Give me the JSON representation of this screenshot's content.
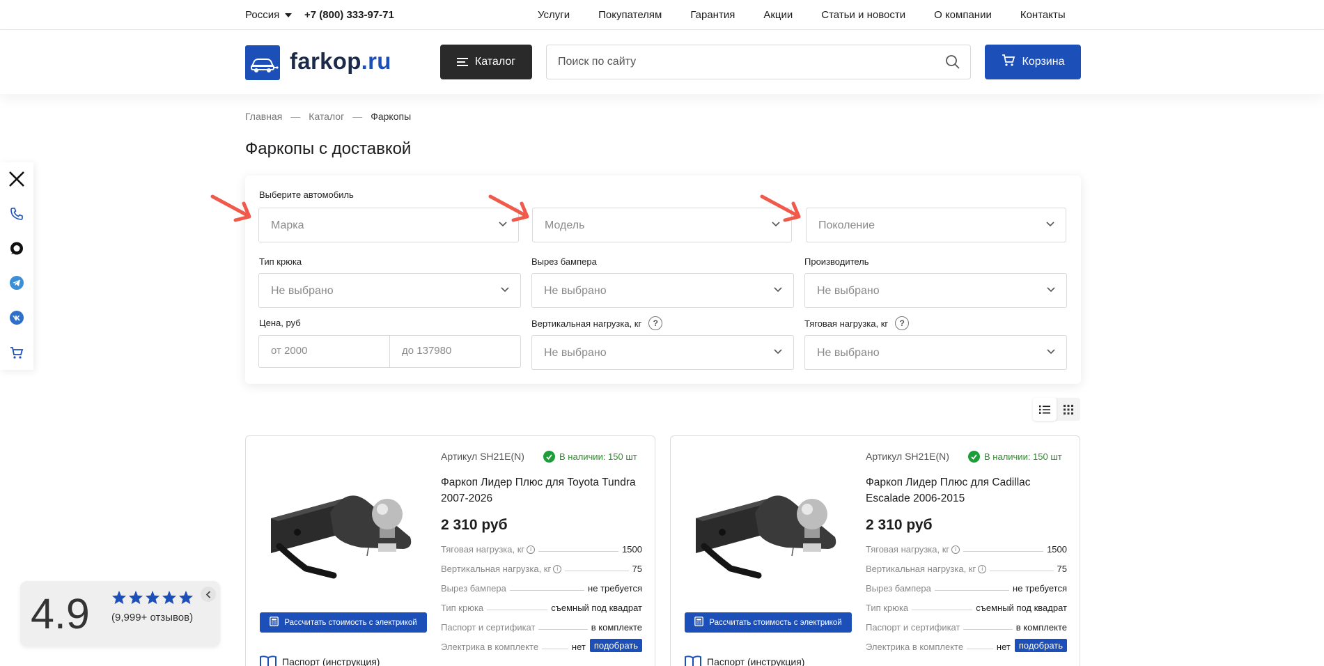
{
  "topbar": {
    "region": "Россия",
    "phone": "+7 (800) 333-97-71",
    "nav": [
      "Услуги",
      "Покупателям",
      "Гарантия",
      "Акции",
      "Статьи и новости",
      "О компании",
      "Контакты"
    ]
  },
  "header": {
    "logo_main": "farkop",
    "logo_tld": ".ru",
    "catalog_label": "Каталог",
    "search_placeholder": "Поиск по сайту",
    "cart_label": "Корзина"
  },
  "breadcrumb": {
    "items": [
      "Главная",
      "Каталог",
      "Фаркопы"
    ],
    "separator": "—"
  },
  "page_title": "Фаркопы с доставкой",
  "filters": {
    "car_label": "Выберите автомобиль",
    "make_placeholder": "Марка",
    "model_placeholder": "Модель",
    "generation_placeholder": "Поколение",
    "hook_type_label": "Тип крюка",
    "bumper_cut_label": "Вырез бампера",
    "manufacturer_label": "Производитель",
    "price_label": "Цена, руб",
    "price_from_placeholder": "от 2000",
    "price_to_placeholder": "до 137980",
    "vertical_load_label": "Вертикальная нагрузка, кг",
    "towing_load_label": "Тяговая нагрузка, кг",
    "not_selected": "Не выбрано",
    "help_symbol": "?"
  },
  "products": [
    {
      "sku": "Артикул SH21E(N)",
      "stock": "В наличии: 150 шт",
      "title": "Фаркоп Лидер Плюс для Toyota Tundra 2007-2026",
      "price": "2 310 руб",
      "calc_label": "Рассчитать стоимость с электрикой",
      "passport_label": "Паспорт (инструкция)",
      "specs": [
        {
          "name": "Тяговая нагрузка, кг",
          "value": "1500"
        },
        {
          "name": "Вертикальная нагрузка, кг",
          "value": "75"
        },
        {
          "name": "Вырез бампера",
          "value": "не требуется"
        },
        {
          "name": "Тип крюка",
          "value": "съемный под квадрат"
        },
        {
          "name": "Паспорт и сертификат",
          "value": "в комплекте"
        },
        {
          "name": "Электрика в комплекте",
          "value": "нет"
        }
      ],
      "pick_label": "подобрать"
    },
    {
      "sku": "Артикул SH21E(N)",
      "stock": "В наличии: 150 шт",
      "title": "Фаркоп Лидер Плюс для Cadillac Escalade 2006-2015",
      "price": "2 310 руб",
      "calc_label": "Рассчитать стоимость с электрикой",
      "passport_label": "Паспорт (инструкция)",
      "specs": [
        {
          "name": "Тяговая нагрузка, кг",
          "value": "1500"
        },
        {
          "name": "Вертикальная нагрузка, кг",
          "value": "75"
        },
        {
          "name": "Вырез бампера",
          "value": "не требуется"
        },
        {
          "name": "Тип крюка",
          "value": "съемный под квадрат"
        },
        {
          "name": "Паспорт и сертификат",
          "value": "в комплекте"
        },
        {
          "name": "Электрика в комплекте",
          "value": "нет"
        }
      ],
      "pick_label": "подобрать"
    }
  ],
  "rating": {
    "score": "4.9",
    "reviews": "(9,999+ отзывов)",
    "stars": 5
  },
  "colors": {
    "brand_blue": "#1c4fb8",
    "dark_button": "#2a2a2a",
    "stock_green": "#1f9d3a",
    "arrow_red": "#ef5a4b"
  },
  "side_icons": [
    "close-icon",
    "phone-icon",
    "chat-icon",
    "telegram-icon",
    "vk-icon",
    "cart-icon"
  ]
}
